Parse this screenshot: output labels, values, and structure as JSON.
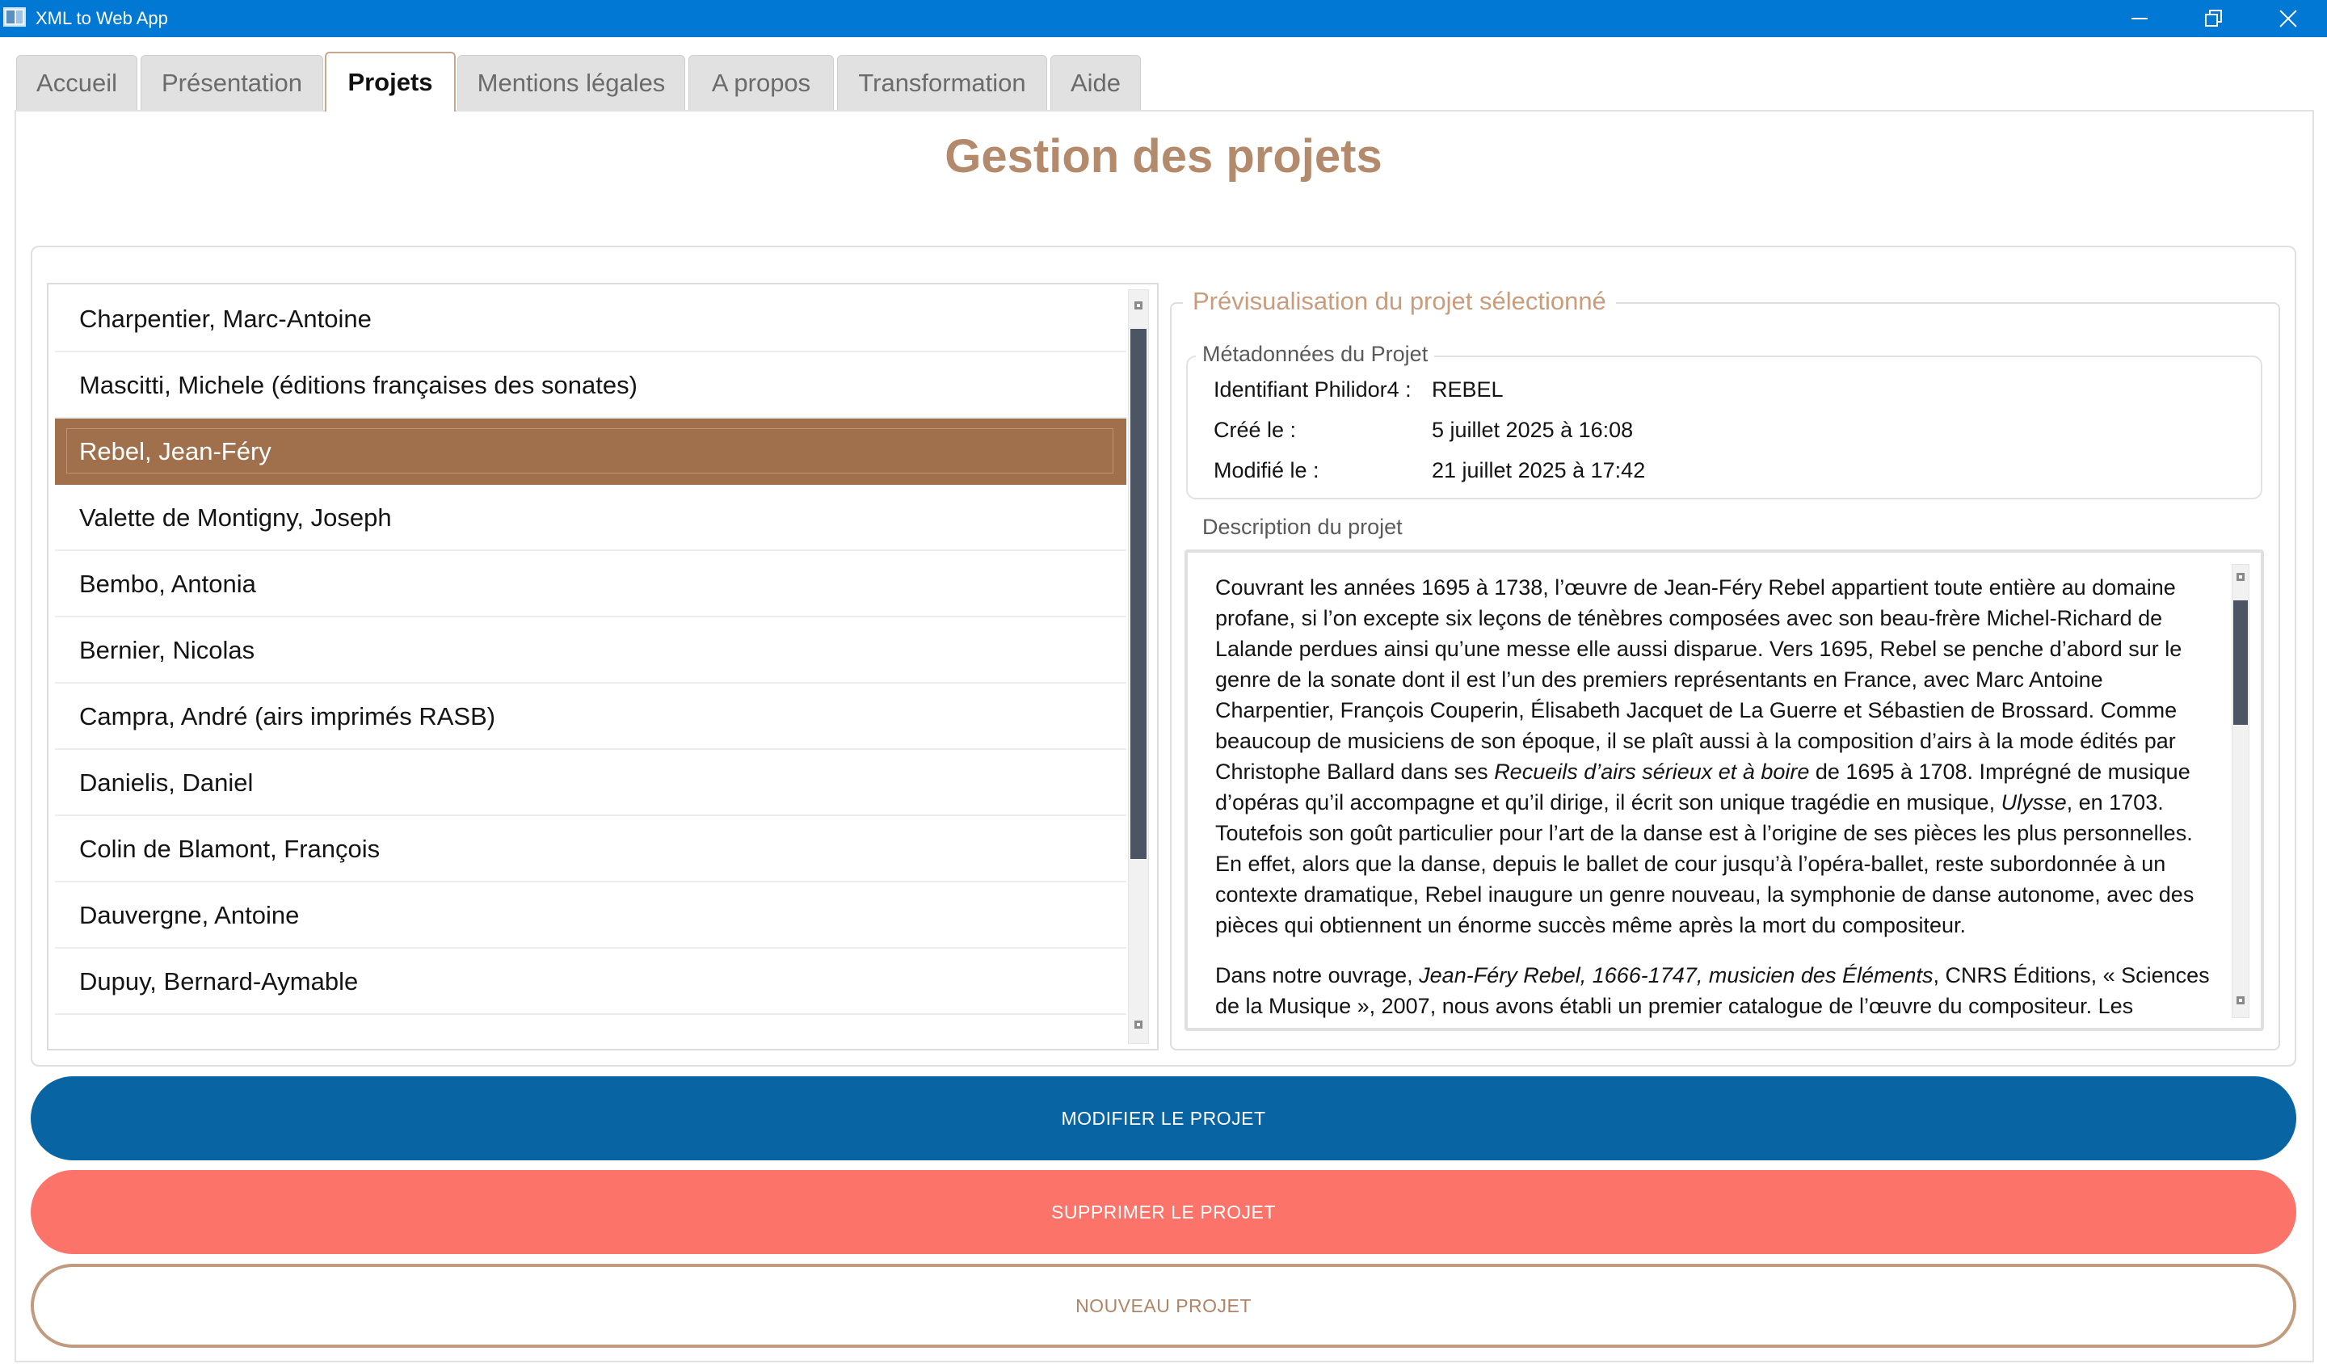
{
  "window": {
    "title": "XML to Web App",
    "icon": "app-window-icon",
    "controls": [
      "minimize-icon",
      "restore-icon",
      "close-icon"
    ]
  },
  "tabs": [
    {
      "label": "Accueil",
      "active": false
    },
    {
      "label": "Présentation",
      "active": false
    },
    {
      "label": "Projets",
      "active": true
    },
    {
      "label": "Mentions légales",
      "active": false
    },
    {
      "label": "A propos",
      "active": false
    },
    {
      "label": "Transformation",
      "active": false
    },
    {
      "label": "Aide",
      "active": false
    }
  ],
  "page": {
    "title": "Gestion des projets"
  },
  "projects": {
    "items": [
      "Charpentier, Marc-Antoine",
      "Mascitti, Michele (éditions françaises des sonates)",
      "Rebel, Jean-Féry",
      "Valette de Montigny, Joseph",
      "Bembo, Antonia",
      "Bernier, Nicolas",
      "Campra, André (airs imprimés RASB)",
      "Danielis, Daniel",
      "Colin de Blamont, François",
      "Dauvergne, Antoine",
      "Dupuy, Bernard-Aymable"
    ],
    "selected_index": 2
  },
  "preview": {
    "legend": "Prévisualisation du projet sélectionné",
    "metadata": {
      "legend": "Métadonnées du Projet",
      "identifier_label": "Identifiant Philidor4 :",
      "identifier_value": "REBEL",
      "created_label": "Créé le :",
      "created_value": "5 juillet 2025 à 16:08",
      "modified_label": "Modifié le :",
      "modified_value": "21 juillet 2025 à 17:42"
    },
    "description_label": "Description du projet",
    "description": {
      "p1_a": "Couvrant les années 1695 à 1738, l’œuvre de Jean-Féry Rebel appartient toute entière au domaine profane, si l’on excepte six leçons de ténèbres composées avec son beau-frère Michel-Richard de Lalande perdues ainsi qu’une messe elle aussi disparue. Vers 1695, Rebel se penche d’abord sur le genre de la sonate dont il est l’un des premiers représentants en France, avec Marc Antoine Charpentier, François Couperin, Élisabeth Jacquet de La Guerre et Sébastien de Brossard. Comme beaucoup de musiciens de son époque, il se plaît aussi à la composition d’airs à la mode édités par Christophe Ballard dans ses ",
      "p1_em1": "Recueils d’airs sérieux et à boire",
      "p1_b": " de 1695 à 1708. Imprégné de musique d’opéras qu’il accompagne et qu’il dirige, il écrit son unique tragédie en musique, ",
      "p1_em2": "Ulysse",
      "p1_c": ", en 1703. Toutefois son goût particulier pour l’art de la danse est à l’origine de ses pièces les plus personnelles. En effet, alors que la danse, depuis le ballet de cour jusqu’à l’opéra-ballet, reste subordonnée à un contexte dramatique, Rebel inaugure un genre nouveau, la symphonie de danse autonome, avec des pièces qui obtiennent un énorme succès même après la mort du compositeur.",
      "p2_a": "Dans notre ouvrage, ",
      "p2_em": "Jean-Féry Rebel, 1666-1747, musicien des Éléments",
      "p2_b": ", CNRS Éditions, « Sciences de la Musique », 2007, nous avons établi un premier catalogue de l’œuvre du compositeur. Les"
    }
  },
  "actions": {
    "modify": "MODIFIER LE PROJET",
    "delete": "SUPPRIMER LE PROJET",
    "new": "NOUVEAU PROJET"
  },
  "colors": {
    "titlebar": "#0078d4",
    "accent_brown": "#a0704d",
    "title_brown": "#b48a6c",
    "modify_blue": "#0864a3",
    "delete_red": "#fb7369"
  }
}
